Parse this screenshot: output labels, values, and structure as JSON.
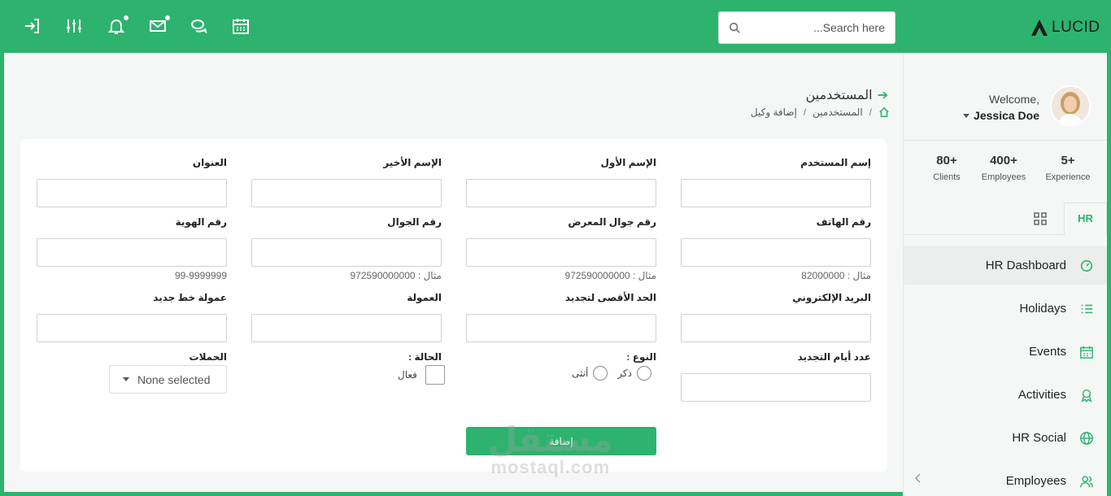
{
  "topbar": {
    "search_placeholder": "Search here...",
    "logo_text": "LUCID",
    "icons": [
      "sign-in-icon",
      "sliders-icon",
      "bell-icon",
      "mail-icon",
      "chat-icon",
      "calendar-icon"
    ]
  },
  "header": {
    "title": "المستخدمين",
    "breadcrumb": [
      "المستخدمين",
      "إضافة وكيل"
    ]
  },
  "form": {
    "username": {
      "label": "إسم المستخدم"
    },
    "first_name": {
      "label": "الإسم الأول"
    },
    "last_name": {
      "label": "الإسم الأخير"
    },
    "address": {
      "label": "العنوان"
    },
    "phone": {
      "label": "رقم الهاتف",
      "hint": "مثال : 82000000"
    },
    "showroom_mobile": {
      "label": "رقم جوال المعرض",
      "hint": "مثال : 972590000000"
    },
    "mobile": {
      "label": "رقم الجوال",
      "hint": "مثال : 972590000000"
    },
    "id_number": {
      "label": "رقم الهوية",
      "hint": "99-9999999"
    },
    "email": {
      "label": "البريد الإلكتروني"
    },
    "max_renewal": {
      "label": "الحد الأقصى لتجديد"
    },
    "commission": {
      "label": "العمولة"
    },
    "new_line_commission": {
      "label": "عمولة خط جديد"
    },
    "renewal_days": {
      "label": "عدد أيام التجديد"
    },
    "gender": {
      "label": "النوع :",
      "options": [
        "ذكر",
        "أنثى"
      ]
    },
    "status": {
      "label": "الحالة :",
      "option": "فعال"
    },
    "campaigns": {
      "label": "الحملات",
      "selected": "None selected"
    },
    "submit_label": "إضافة"
  },
  "watermark": {
    "arabic": "مستقل",
    "latin": "mostaql.com"
  },
  "sidebar": {
    "welcome": "Welcome,",
    "user_name": "Jessica Doe",
    "stats": [
      {
        "value": "5+",
        "label": "Experience"
      },
      {
        "value": "400+",
        "label": "Employees"
      },
      {
        "value": "80+",
        "label": "Clients"
      }
    ],
    "tab_label": "HR",
    "menu": [
      {
        "label": "HR Dashboard",
        "icon": "speedometer-icon"
      },
      {
        "label": "Holidays",
        "icon": "list-icon"
      },
      {
        "label": "Events",
        "icon": "calendar-icon"
      },
      {
        "label": "Activities",
        "icon": "award-icon"
      },
      {
        "label": "HR Social",
        "icon": "globe-icon"
      },
      {
        "label": "Employees",
        "icon": "users-icon"
      }
    ]
  },
  "colors": {
    "brand": "#2db36e",
    "background": "#f4f7f6",
    "card": "#ffffff"
  }
}
